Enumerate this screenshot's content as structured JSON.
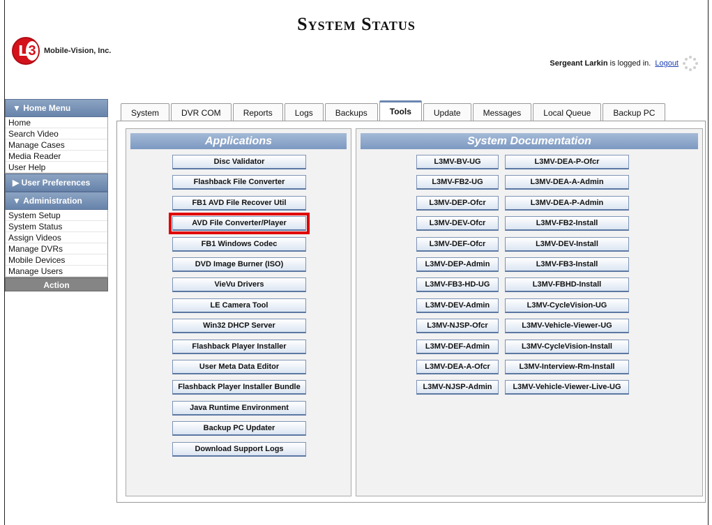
{
  "header": {
    "title": "System Status",
    "company": "Mobile-Vision, Inc.",
    "user_name": "Sergeant Larkin",
    "logged_in_suffix": "is logged in.",
    "logout_label": "Logout"
  },
  "sidebar": {
    "home_menu_label": "Home Menu",
    "home_items": [
      "Home",
      "Search Video",
      "Manage Cases",
      "Media Reader",
      "User Help"
    ],
    "user_prefs_label": "User Preferences",
    "admin_label": "Administration",
    "admin_items": [
      "System Setup",
      "System Status",
      "Assign Videos",
      "Manage DVRs",
      "Mobile Devices",
      "Manage Users"
    ],
    "action_label": "Action"
  },
  "tabs": [
    "System",
    "DVR COM",
    "Reports",
    "Logs",
    "Backups",
    "Tools",
    "Update",
    "Messages",
    "Local Queue",
    "Backup PC"
  ],
  "active_tab": "Tools",
  "applications": {
    "title": "Applications",
    "items": [
      "Disc Validator",
      "Flashback File Converter",
      "FB1 AVD File Recover Util",
      "AVD File Converter/Player",
      "FB1 Windows Codec",
      "DVD Image Burner (ISO)",
      "VieVu Drivers",
      "LE Camera Tool",
      "Win32 DHCP Server",
      "Flashback Player Installer",
      "User Meta Data Editor",
      "Flashback Player Installer Bundle",
      "Java Runtime Environment",
      "Backup PC Updater",
      "Download Support Logs"
    ],
    "highlighted": "AVD File Converter/Player"
  },
  "documentation": {
    "title": "System Documentation",
    "left_items": [
      "L3MV-BV-UG",
      "L3MV-FB2-UG",
      "L3MV-DEP-Ofcr",
      "L3MV-DEV-Ofcr",
      "L3MV-DEF-Ofcr",
      "L3MV-DEP-Admin",
      "L3MV-FB3-HD-UG",
      "L3MV-DEV-Admin",
      "L3MV-NJSP-Ofcr",
      "L3MV-DEF-Admin",
      "L3MV-DEA-A-Ofcr",
      "L3MV-NJSP-Admin"
    ],
    "right_items": [
      "L3MV-DEA-P-Ofcr",
      "L3MV-DEA-A-Admin",
      "L3MV-DEA-P-Admin",
      "L3MV-FB2-Install",
      "L3MV-DEV-Install",
      "L3MV-FB3-Install",
      "L3MV-FBHD-Install",
      "L3MV-CycleVision-UG",
      "L3MV-Vehicle-Viewer-UG",
      "L3MV-CycleVision-Install",
      "L3MV-Interview-Rm-Install",
      "L3MV-Vehicle-Viewer-Live-UG"
    ]
  },
  "colors": {
    "highlight": "#e00000",
    "header_blue": "#7d99c2",
    "logo_red": "#d4121c"
  }
}
